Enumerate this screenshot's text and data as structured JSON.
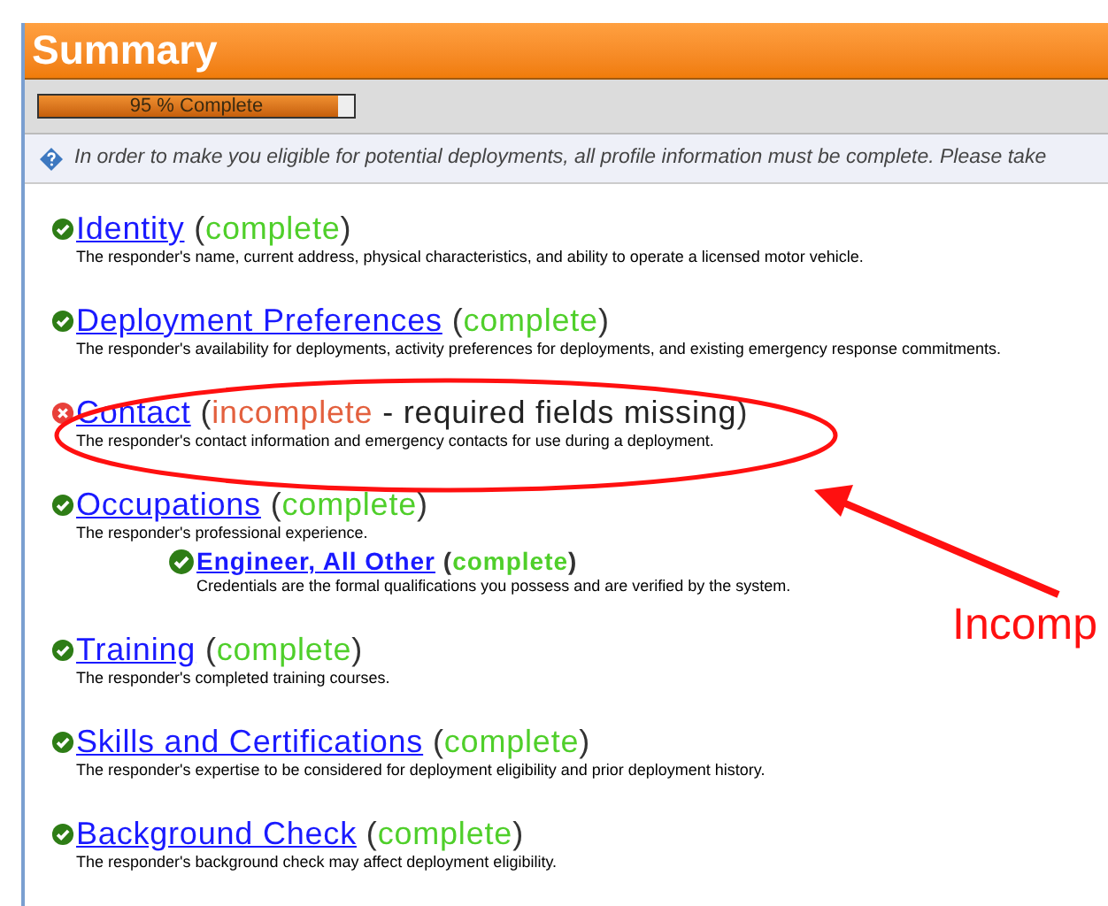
{
  "header": {
    "title": "Summary"
  },
  "progress": {
    "label": "95 % Complete",
    "level": 0.95
  },
  "info": {
    "text": "In order to make you eligible for potential deployments, all profile information must be complete. Please take"
  },
  "sections": [
    {
      "title": "Identity",
      "open": "(",
      "complete": true,
      "status": "complete",
      "close": ")",
      "description": "The responder's name, current address, physical characteristics, and ability to operate a licensed motor vehicle."
    },
    {
      "title": "Deployment Preferences",
      "open": "(",
      "complete": true,
      "status": "complete",
      "close": ")",
      "description": "The responder's availability for deployments, activity preferences for deployments, and existing emergency response commitments."
    },
    {
      "title": "Contact",
      "open": "(",
      "complete": false,
      "status": "incomplete",
      "note": "- required fields missing",
      "close": ")",
      "description": "The responder's contact information and emergency contacts for use during a deployment."
    },
    {
      "title": "Occupations",
      "open": "(",
      "complete": true,
      "status": "complete",
      "close": ")",
      "description": "The responder's professional experience.",
      "children": [
        {
          "title": "Engineer, All Other",
          "open": "(",
          "complete": true,
          "status": "complete",
          "close": ")",
          "description": "Credentials are the formal qualifications you possess and are verified by the system."
        }
      ]
    },
    {
      "title": "Training",
      "open": "(",
      "complete": true,
      "status": "complete",
      "close": ")",
      "description": "The responder's completed training courses."
    },
    {
      "title": "Skills and Certifications",
      "open": "(",
      "complete": true,
      "status": "complete",
      "close": ")",
      "description": "The responder's expertise to be considered for deployment eligibility and prior deployment history."
    },
    {
      "title": "Background Check",
      "open": "(",
      "complete": true,
      "status": "complete",
      "close": ")",
      "description": "The responder's background check may affect deployment eligibility."
    }
  ],
  "annotation": {
    "label": "Incomp"
  }
}
